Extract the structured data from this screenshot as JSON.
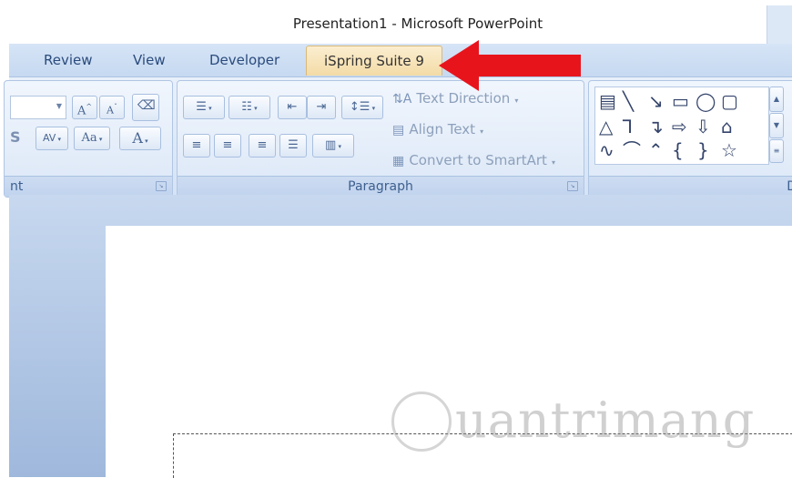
{
  "window": {
    "title": "Presentation1 - Microsoft PowerPoint"
  },
  "tabs": [
    {
      "label": "Review"
    },
    {
      "label": "View"
    },
    {
      "label": "Developer"
    },
    {
      "label": "iSpring Suite 9",
      "highlighted": true
    }
  ],
  "ribbon": {
    "font_group": {
      "label": "nt",
      "grow_font": "A",
      "shrink_font": "A",
      "char_spacing": "AV",
      "change_case": "Aa",
      "font_color": "A",
      "shadow_fragment": "S"
    },
    "paragraph_group": {
      "label": "Paragraph",
      "text_direction": "Text Direction",
      "align_text": "Align Text",
      "convert_smartart": "Convert to SmartArt"
    },
    "drawing_group": {
      "label": "D"
    }
  },
  "watermark": {
    "text": "uantrimang"
  },
  "colors": {
    "arrow": "#e8141c",
    "accent_tab": "#f5dfae",
    "ribbon_bg": "#dbe7f7"
  }
}
